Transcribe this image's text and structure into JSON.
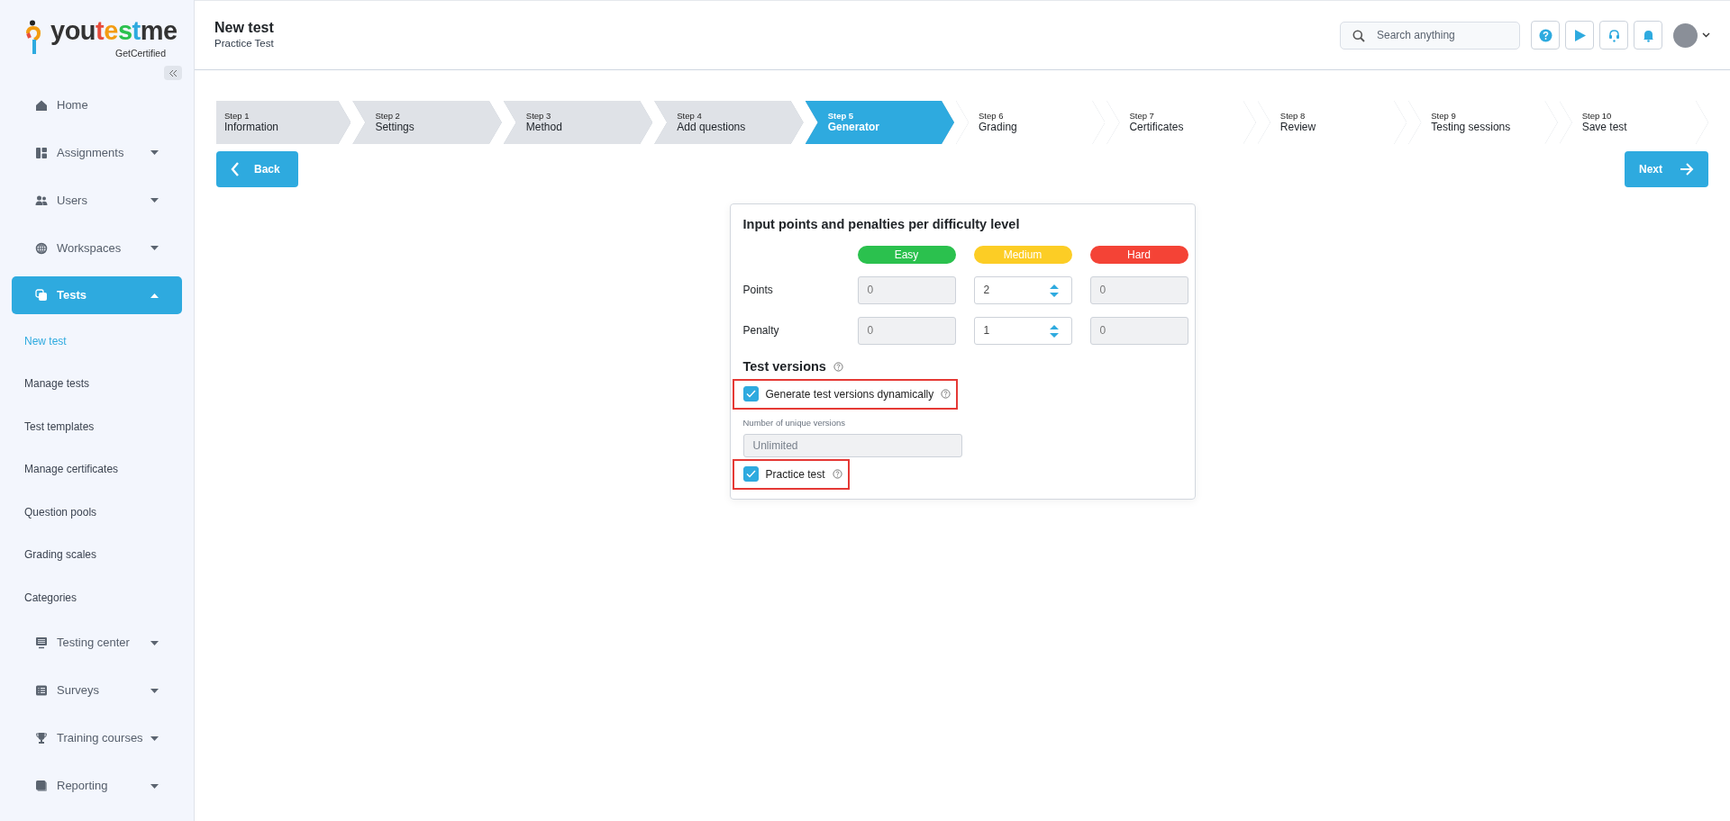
{
  "logo": {
    "name": "youtestme",
    "tagline": "GetCertified"
  },
  "sidebar": {
    "items": [
      {
        "label": "Home",
        "selected": false
      },
      {
        "label": "Assignments",
        "expanded": false,
        "selected": false
      },
      {
        "label": "Users",
        "expanded": false,
        "selected": false
      },
      {
        "label": "Workspaces",
        "expanded": false,
        "selected": false
      },
      {
        "label": "Tests",
        "expanded": true,
        "selected": true,
        "children": [
          {
            "label": "New test",
            "selected": true
          },
          {
            "label": "Manage tests",
            "selected": false
          },
          {
            "label": "Test templates",
            "selected": false
          },
          {
            "label": "Manage certificates",
            "selected": false
          },
          {
            "label": "Question pools",
            "selected": false
          },
          {
            "label": "Grading scales",
            "selected": false
          },
          {
            "label": "Categories",
            "selected": false
          }
        ]
      },
      {
        "label": "Testing center",
        "expanded": false,
        "selected": false
      },
      {
        "label": "Surveys",
        "expanded": false,
        "selected": false
      },
      {
        "label": "Training courses",
        "expanded": false,
        "selected": false
      },
      {
        "label": "Reporting",
        "expanded": false,
        "selected": false
      }
    ]
  },
  "header": {
    "title": "New test",
    "subtitle": "Practice Test",
    "search": {
      "placeholder": "Search anything"
    }
  },
  "steps": [
    {
      "step": "Step 1",
      "name": "Information",
      "completed": true,
      "selected": false
    },
    {
      "step": "Step 2",
      "name": "Settings",
      "completed": true,
      "selected": false
    },
    {
      "step": "Step 3",
      "name": "Method",
      "completed": true,
      "selected": false
    },
    {
      "step": "Step 4",
      "name": "Add questions",
      "completed": true,
      "selected": false
    },
    {
      "step": "Step 5",
      "name": "Generator",
      "selected": true
    },
    {
      "step": "Step 6",
      "name": "Grading",
      "completed": false,
      "selected": false
    },
    {
      "step": "Step 7",
      "name": "Certificates",
      "completed": false,
      "selected": false
    },
    {
      "step": "Step 8",
      "name": "Review",
      "completed": false,
      "selected": false
    },
    {
      "step": "Step 9",
      "name": "Testing sessions",
      "completed": false,
      "selected": false
    },
    {
      "step": "Step 10",
      "name": "Save test",
      "completed": false,
      "selected": false
    }
  ],
  "back_button": "Back",
  "next_button": "Next",
  "card": {
    "title": "Input points and penalties per difficulty level",
    "levels": [
      {
        "label": "Easy",
        "color": "#2bc14e"
      },
      {
        "label": "Medium",
        "color": "#fccd25"
      },
      {
        "label": "Hard",
        "color": "#f44336"
      }
    ],
    "rows": [
      {
        "label": "Points",
        "values": [
          {
            "value": "0",
            "disabled": true
          },
          {
            "value": "2",
            "disabled": false
          },
          {
            "value": "0",
            "disabled": true
          }
        ]
      },
      {
        "label": "Penalty",
        "values": [
          {
            "value": "0",
            "disabled": true
          },
          {
            "value": "1",
            "disabled": false
          },
          {
            "value": "0",
            "disabled": true
          }
        ]
      }
    ],
    "versions_title": "Test versions",
    "dynamic": {
      "label": "Generate test versions dynamically",
      "checked": true,
      "highlighted": true
    },
    "unique_versions": {
      "label": "Number of unique versions",
      "value": "Unlimited",
      "disabled": true
    },
    "practice": {
      "label": "Practice test",
      "checked": true,
      "highlighted": true
    }
  }
}
